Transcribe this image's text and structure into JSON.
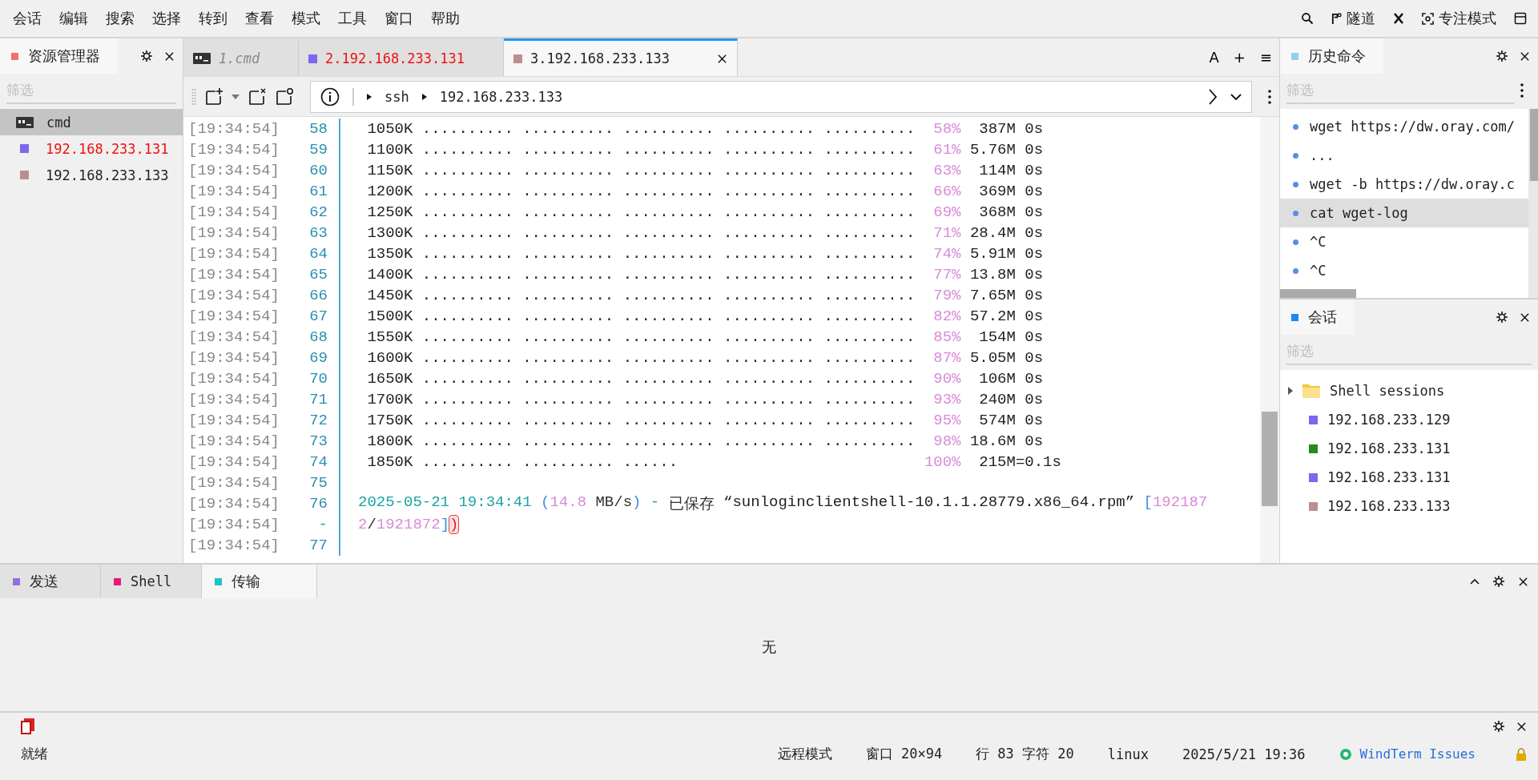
{
  "menu": [
    "会话",
    "编辑",
    "搜索",
    "选择",
    "转到",
    "查看",
    "模式",
    "工具",
    "窗口",
    "帮助"
  ],
  "menu_right": {
    "tunnel": "隧道",
    "focus": "专注模式"
  },
  "explorer": {
    "title": "资源管理器",
    "filter_placeholder": "筛选",
    "items": [
      {
        "kind": "cmd",
        "label": "cmd",
        "selected": true,
        "alert": false
      },
      {
        "kind": "session",
        "label": "192.168.233.131",
        "color": "#7b68ee",
        "selected": false,
        "alert": true
      },
      {
        "kind": "session",
        "label": "192.168.233.133",
        "color": "#bc8f8f",
        "selected": false,
        "alert": false
      }
    ]
  },
  "tabs": [
    {
      "kind": "cmd",
      "label": "1.cmd",
      "selected": false,
      "alert": false,
      "dimmed": true
    },
    {
      "kind": "session",
      "label": "2.192.168.233.131",
      "color": "#7b68ee",
      "selected": false,
      "alert": true,
      "dimmed": false
    },
    {
      "kind": "session",
      "label": "3.192.168.233.133",
      "color": "#bc8f8f",
      "selected": true,
      "alert": false,
      "dimmed": false
    }
  ],
  "tab_actions": [
    "A",
    "+",
    "≡"
  ],
  "address": {
    "protocol": "ssh",
    "host": "192.168.233.133"
  },
  "terminal": {
    "rows": [
      {
        "time": "[19:34:54]",
        "num": "58",
        "kind": "progress",
        "size": "1050K",
        "dots": ".......... .......... .......... .......... ..........",
        "percent": "58%",
        "speed": "387M",
        "eta": "0s"
      },
      {
        "time": "[19:34:54]",
        "num": "59",
        "kind": "progress",
        "size": "1100K",
        "dots": ".......... .......... .......... .......... ..........",
        "percent": "61%",
        "speed": "5.76M",
        "eta": "0s"
      },
      {
        "time": "[19:34:54]",
        "num": "60",
        "kind": "progress",
        "size": "1150K",
        "dots": ".......... .......... .......... .......... ..........",
        "percent": "63%",
        "speed": "114M",
        "eta": "0s"
      },
      {
        "time": "[19:34:54]",
        "num": "61",
        "kind": "progress",
        "size": "1200K",
        "dots": ".......... .......... .......... .......... ..........",
        "percent": "66%",
        "speed": "369M",
        "eta": "0s"
      },
      {
        "time": "[19:34:54]",
        "num": "62",
        "kind": "progress",
        "size": "1250K",
        "dots": ".......... .......... .......... .......... ..........",
        "percent": "69%",
        "speed": "368M",
        "eta": "0s"
      },
      {
        "time": "[19:34:54]",
        "num": "63",
        "kind": "progress",
        "size": "1300K",
        "dots": ".......... .......... .......... .......... ..........",
        "percent": "71%",
        "speed": "28.4M",
        "eta": "0s"
      },
      {
        "time": "[19:34:54]",
        "num": "64",
        "kind": "progress",
        "size": "1350K",
        "dots": ".......... .......... .......... .......... ..........",
        "percent": "74%",
        "speed": "5.91M",
        "eta": "0s"
      },
      {
        "time": "[19:34:54]",
        "num": "65",
        "kind": "progress",
        "size": "1400K",
        "dots": ".......... .......... .......... .......... ..........",
        "percent": "77%",
        "speed": "13.8M",
        "eta": "0s"
      },
      {
        "time": "[19:34:54]",
        "num": "66",
        "kind": "progress",
        "size": "1450K",
        "dots": ".......... .......... .......... .......... ..........",
        "percent": "79%",
        "speed": "7.65M",
        "eta": "0s"
      },
      {
        "time": "[19:34:54]",
        "num": "67",
        "kind": "progress",
        "size": "1500K",
        "dots": ".......... .......... .......... .......... ..........",
        "percent": "82%",
        "speed": "57.2M",
        "eta": "0s"
      },
      {
        "time": "[19:34:54]",
        "num": "68",
        "kind": "progress",
        "size": "1550K",
        "dots": ".......... .......... .......... .......... ..........",
        "percent": "85%",
        "speed": "154M",
        "eta": "0s"
      },
      {
        "time": "[19:34:54]",
        "num": "69",
        "kind": "progress",
        "size": "1600K",
        "dots": ".......... .......... .......... .......... ..........",
        "percent": "87%",
        "speed": "5.05M",
        "eta": "0s"
      },
      {
        "time": "[19:34:54]",
        "num": "70",
        "kind": "progress",
        "size": "1650K",
        "dots": ".......... .......... .......... .......... ..........",
        "percent": "90%",
        "speed": "106M",
        "eta": "0s"
      },
      {
        "time": "[19:34:54]",
        "num": "71",
        "kind": "progress",
        "size": "1700K",
        "dots": ".......... .......... .......... .......... ..........",
        "percent": "93%",
        "speed": "240M",
        "eta": "0s"
      },
      {
        "time": "[19:34:54]",
        "num": "72",
        "kind": "progress",
        "size": "1750K",
        "dots": ".......... .......... .......... .......... ..........",
        "percent": "95%",
        "speed": "574M",
        "eta": "0s"
      },
      {
        "time": "[19:34:54]",
        "num": "73",
        "kind": "progress",
        "size": "1800K",
        "dots": ".......... .......... .......... .......... ..........",
        "percent": "98%",
        "speed": "18.6M",
        "eta": "0s"
      },
      {
        "time": "[19:34:54]",
        "num": "74",
        "kind": "final",
        "size": "1850K",
        "dots": ".......... .......... ......",
        "percent": "100%",
        "speed": "215M",
        "eta": "=0.1s"
      },
      {
        "time": "[19:34:54]",
        "num": "75",
        "kind": "blank"
      },
      {
        "time": "[19:34:54]",
        "num": "76",
        "kind": "log",
        "segments": [
          {
            "text": "2025-05-21 19:34:41",
            "color": "#1aa3a3",
            "space_before": false
          },
          {
            "text": "(",
            "color": "#3a8ee6",
            "space_before": true
          },
          {
            "text": "14.8",
            "color": "#d98ad8",
            "space_before": false
          },
          {
            "text": "MB/s",
            "color": "#333333",
            "space_before": true
          },
          {
            "text": ")",
            "color": "#3a8ee6",
            "space_before": false
          },
          {
            "text": "-",
            "color": "#1aa3a3",
            "space_before": true
          },
          {
            "text": "已保存",
            "color": "#333333",
            "space_before": true
          },
          {
            "text": "“sunloginclientshell-10.1.1.28779.x86_64.rpm”",
            "color": "#222222",
            "space_before": true
          },
          {
            "text": "[",
            "color": "#3a8ee6",
            "space_before": true
          },
          {
            "text": "192187",
            "color": "#d98ad8",
            "space_before": false
          }
        ]
      },
      {
        "time": "[19:34:54]",
        "num": "-",
        "kind": "log",
        "segments": [
          {
            "text": "2",
            "color": "#d98ad8",
            "space_before": false
          },
          {
            "text": "/",
            "color": "#333333",
            "space_before": false
          },
          {
            "text": "1921872",
            "color": "#d98ad8",
            "space_before": false
          },
          {
            "text": "]",
            "color": "#3a8ee6",
            "space_before": false
          },
          {
            "text": ")",
            "color": "#e02020",
            "space_before": false
          }
        ]
      },
      {
        "time": "[19:34:54]",
        "num": "77",
        "kind": "blank"
      }
    ]
  },
  "history": {
    "title": "历史命令",
    "filter_placeholder": "筛选",
    "items": [
      {
        "text": "wget https://dw.oray.com/",
        "selected": false
      },
      {
        "text": "...",
        "selected": false
      },
      {
        "text": "wget -b https://dw.oray.c",
        "selected": false
      },
      {
        "text": "cat wget-log",
        "selected": true
      },
      {
        "text": "^C",
        "selected": false
      },
      {
        "text": "^C",
        "selected": false
      }
    ]
  },
  "sessions": {
    "title": "会话",
    "filter_placeholder": "筛选",
    "items": [
      {
        "kind": "folder",
        "label": "Shell sessions",
        "expanded": false
      },
      {
        "kind": "session",
        "label": "192.168.233.129",
        "color": "#7b68ee"
      },
      {
        "kind": "session",
        "label": "192.168.233.131",
        "color": "#228b22"
      },
      {
        "kind": "session",
        "label": "192.168.233.131",
        "color": "#7b68ee"
      },
      {
        "kind": "session",
        "label": "192.168.233.133",
        "color": "#bc8f8f"
      }
    ]
  },
  "bottom": {
    "tabs": [
      {
        "label": "发送",
        "color": "#9370db",
        "selected": false
      },
      {
        "label": "Shell",
        "color": "#e8197a",
        "selected": false
      },
      {
        "label": "传输",
        "color": "#20c0c8",
        "selected": true
      }
    ],
    "empty_text": "无"
  },
  "status_bar": {
    "text": "就绪",
    "items": [
      "远程模式",
      "窗口 20×94",
      "行 83 字符 20",
      "linux",
      "2025/5/21 19:36"
    ],
    "link": "WindTerm Issues"
  }
}
